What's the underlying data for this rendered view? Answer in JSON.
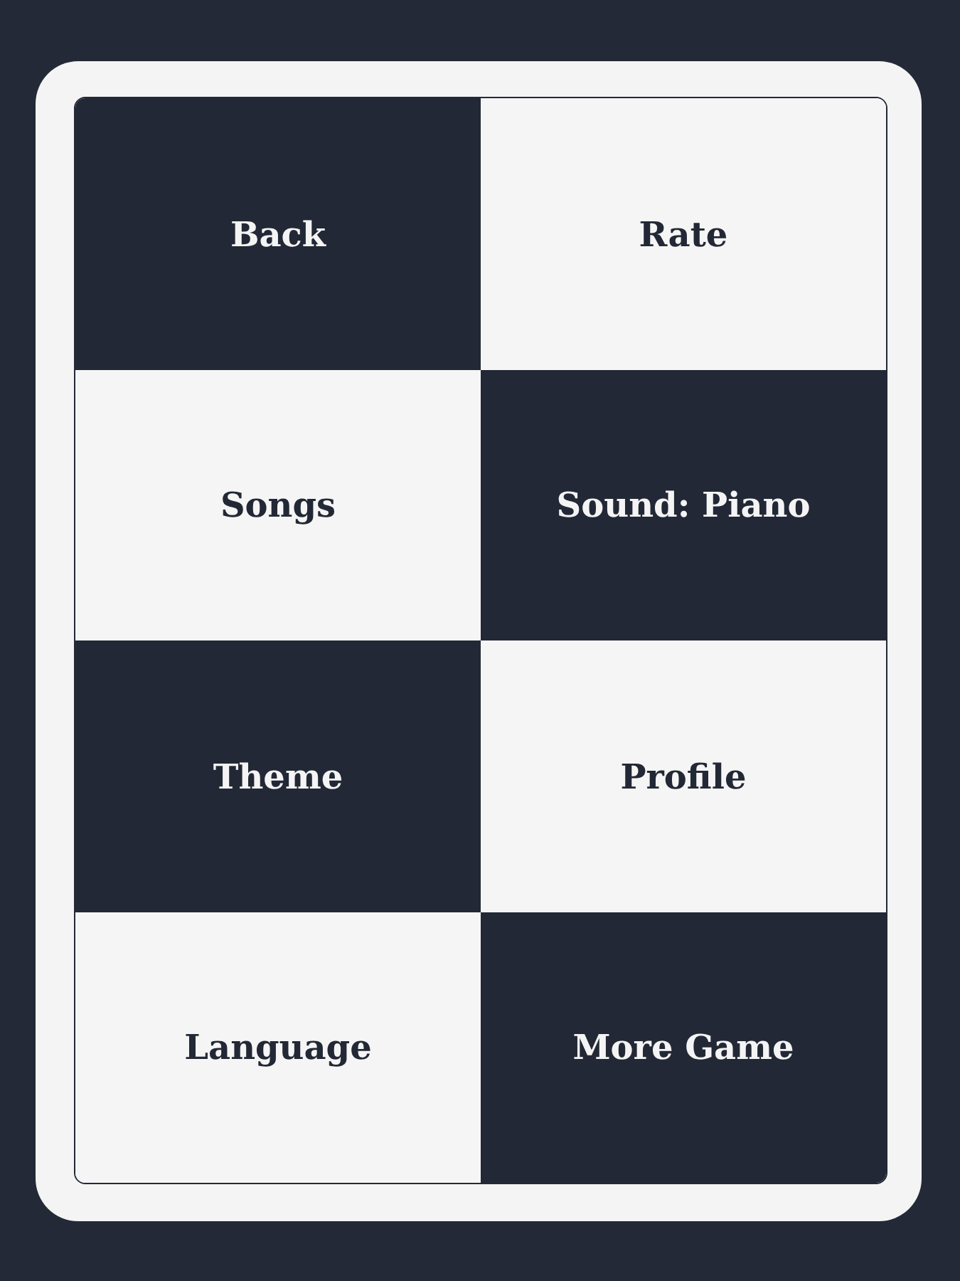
{
  "menu": [
    {
      "label": "Back",
      "kind": "dark"
    },
    {
      "label": "Rate",
      "kind": "light"
    },
    {
      "label": "Songs",
      "kind": "light"
    },
    {
      "label": "Sound: Piano",
      "kind": "dark"
    },
    {
      "label": "Theme",
      "kind": "dark"
    },
    {
      "label": "Profile",
      "kind": "light"
    },
    {
      "label": "Language",
      "kind": "light"
    },
    {
      "label": "More Game",
      "kind": "dark"
    }
  ]
}
